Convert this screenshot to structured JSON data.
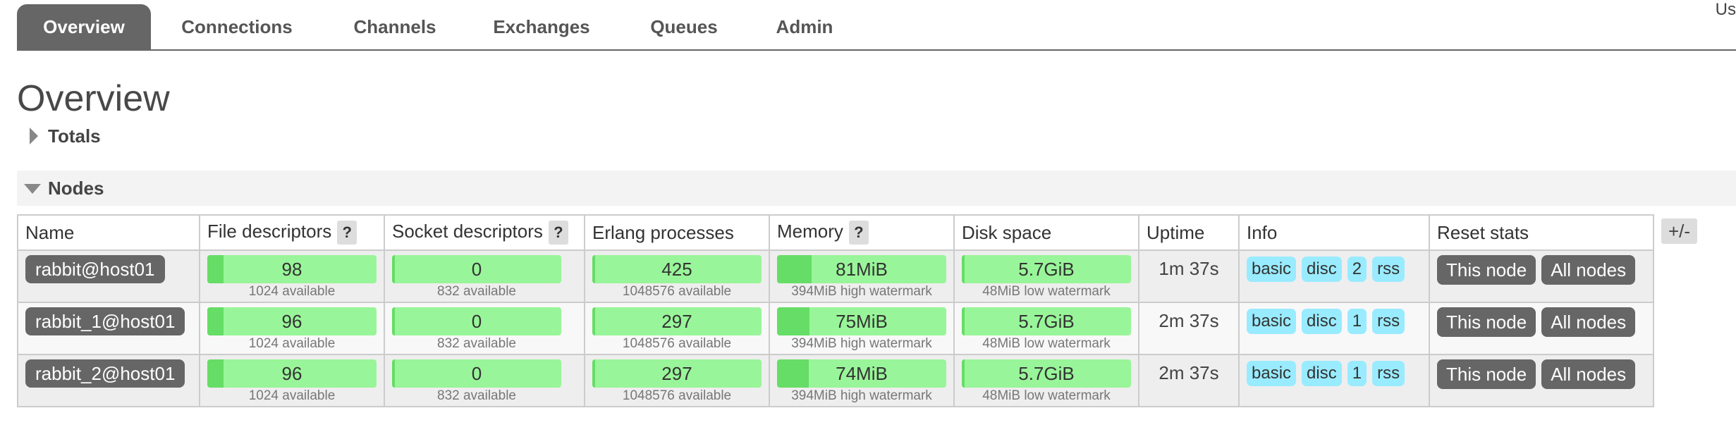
{
  "nav": {
    "tabs": [
      {
        "label": "Overview",
        "active": true
      },
      {
        "label": "Connections"
      },
      {
        "label": "Channels"
      },
      {
        "label": "Exchanges"
      },
      {
        "label": "Queues"
      },
      {
        "label": "Admin"
      }
    ],
    "user_label": "Us"
  },
  "page_title": "Overview",
  "totals": {
    "label": "Totals"
  },
  "nodes_section": {
    "label": "Nodes"
  },
  "table": {
    "headers": {
      "name": "Name",
      "file_descriptors": "File descriptors",
      "socket_descriptors": "Socket descriptors",
      "erlang_processes": "Erlang processes",
      "memory": "Memory",
      "disk_space": "Disk space",
      "uptime": "Uptime",
      "info": "Info",
      "reset_stats": "Reset stats"
    },
    "help_label": "?",
    "plus_minus": "+/-",
    "rows": [
      {
        "name": "rabbit@host01",
        "fd": {
          "value": "98",
          "sub": "1024 available",
          "fraction": 0.096
        },
        "sd": {
          "value": "0",
          "sub": "832 available",
          "fraction": 0
        },
        "ep": {
          "value": "425",
          "sub": "1048576 available",
          "fraction": 0.0004
        },
        "mem": {
          "value": "81MiB",
          "sub": "394MiB high watermark",
          "fraction": 0.206
        },
        "disk": {
          "value": "5.7GiB",
          "sub": "48MiB low watermark",
          "fraction": 0.0
        },
        "uptime": "1m 37s",
        "info": [
          "basic",
          "disc",
          "2",
          "rss"
        ],
        "reset": {
          "this_node": "This node",
          "all_nodes": "All nodes"
        }
      },
      {
        "name": "rabbit_1@host01",
        "fd": {
          "value": "96",
          "sub": "1024 available",
          "fraction": 0.094
        },
        "sd": {
          "value": "0",
          "sub": "832 available",
          "fraction": 0
        },
        "ep": {
          "value": "297",
          "sub": "1048576 available",
          "fraction": 0.0003
        },
        "mem": {
          "value": "75MiB",
          "sub": "394MiB high watermark",
          "fraction": 0.19
        },
        "disk": {
          "value": "5.7GiB",
          "sub": "48MiB low watermark",
          "fraction": 0.0
        },
        "uptime": "2m 37s",
        "info": [
          "basic",
          "disc",
          "1",
          "rss"
        ],
        "reset": {
          "this_node": "This node",
          "all_nodes": "All nodes"
        }
      },
      {
        "name": "rabbit_2@host01",
        "fd": {
          "value": "96",
          "sub": "1024 available",
          "fraction": 0.094
        },
        "sd": {
          "value": "0",
          "sub": "832 available",
          "fraction": 0
        },
        "ep": {
          "value": "297",
          "sub": "1048576 available",
          "fraction": 0.0003
        },
        "mem": {
          "value": "74MiB",
          "sub": "394MiB high watermark",
          "fraction": 0.188
        },
        "disk": {
          "value": "5.7GiB",
          "sub": "48MiB low watermark",
          "fraction": 0.0
        },
        "uptime": "2m 37s",
        "info": [
          "basic",
          "disc",
          "1",
          "rss"
        ],
        "reset": {
          "this_node": "This node",
          "all_nodes": "All nodes"
        }
      }
    ]
  },
  "colors": {
    "meter_bg": "#99f599",
    "meter_fill": "#66dd66",
    "badge_bg": "#99ebff",
    "button_bg": "#666666"
  }
}
